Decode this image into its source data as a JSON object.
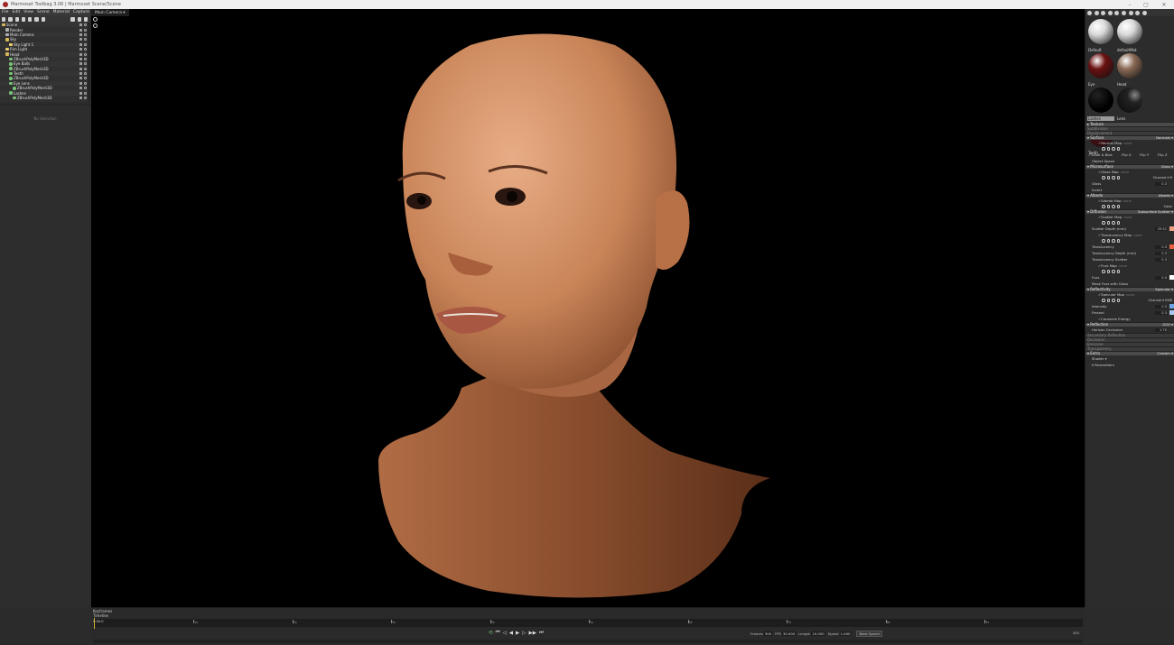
{
  "window": {
    "title": "Marmoset Toolbag 3.06 | Marmoset Scene/Scene",
    "controls": [
      "–",
      "▢",
      "✕"
    ]
  },
  "menu": [
    "File",
    "Edit",
    "View",
    "Scene",
    "Material",
    "Capture",
    "Help"
  ],
  "outliner": {
    "items": [
      {
        "label": "Scene",
        "indent": 0,
        "type": "fold"
      },
      {
        "label": "Render",
        "indent": 1,
        "type": "cam"
      },
      {
        "label": "Main Camera",
        "indent": 1,
        "type": "cam"
      },
      {
        "label": "Sky",
        "indent": 1,
        "type": "fold"
      },
      {
        "label": "Sky Light 1",
        "indent": 2,
        "type": "light"
      },
      {
        "label": "Rim Light",
        "indent": 1,
        "type": "light"
      },
      {
        "label": "Head",
        "indent": 1,
        "type": "fold"
      },
      {
        "label": "ZBrushPolyMesh3D",
        "indent": 2,
        "type": "mesh"
      },
      {
        "label": "Eye Balls",
        "indent": 2,
        "type": "mesh"
      },
      {
        "label": "ZBrushPolyMesh3D",
        "indent": 2,
        "type": "mesh"
      },
      {
        "label": "Teeth",
        "indent": 2,
        "type": "mesh"
      },
      {
        "label": "ZBrushPolyMesh3D",
        "indent": 2,
        "type": "mesh"
      },
      {
        "label": "Eye Lens",
        "indent": 2,
        "type": "mesh"
      },
      {
        "label": "ZBrushPolyMesh3D",
        "indent": 3,
        "type": "mesh"
      },
      {
        "label": "Lashes",
        "indent": 2,
        "type": "mesh"
      },
      {
        "label": "ZBrushPolyMesh3D",
        "indent": 3,
        "type": "mesh"
      }
    ]
  },
  "properties": {
    "empty_label": "No Selection"
  },
  "viewport": {
    "camera_tab": "Main Camera ▾"
  },
  "materials": [
    {
      "label": "Default",
      "color": "#d9d9d9",
      "style": "plain"
    },
    {
      "label": "defaultMat",
      "color": "#d9d9d9",
      "style": "plain"
    },
    {
      "label": "Eye",
      "color": "#6a1010",
      "style": "dark"
    },
    {
      "label": "Head",
      "color": "#8a6a55",
      "style": "skin"
    },
    {
      "label": "Lashes",
      "color": "#050505",
      "style": "black",
      "selected": true
    },
    {
      "label": "Lens",
      "color": "#1a1a1a",
      "style": "glass"
    },
    {
      "label": "Teeth",
      "color": "#4a0e12",
      "style": "teeth"
    }
  ],
  "sections": [
    {
      "kind": "sec",
      "label": "▸ Texture",
      "value": ""
    },
    {
      "kind": "sec",
      "label": "Subdivision",
      "value": "",
      "dim": true
    },
    {
      "kind": "sec",
      "label": "Displacement",
      "value": "",
      "dim": true
    },
    {
      "kind": "sec",
      "label": "▾ Surface",
      "value": "Normals ▾"
    },
    {
      "kind": "row",
      "label": "✓Normal Map",
      "hint": "none"
    },
    {
      "kind": "icons"
    },
    {
      "kind": "flips",
      "label": "✓Scale & Bias",
      "items": [
        "Flip X",
        "Flip Y",
        "Flip Z"
      ]
    },
    {
      "kind": "row",
      "label": "Object Space"
    },
    {
      "kind": "sec",
      "label": "▾ Microsurface",
      "value": "Gloss ▾"
    },
    {
      "kind": "row",
      "label": "✓Gloss Map",
      "hint": "none"
    },
    {
      "kind": "icons",
      "extra": "Channel ▾ R"
    },
    {
      "kind": "row",
      "label": "Gloss",
      "value": "0.3"
    },
    {
      "kind": "row",
      "label": "Invert"
    },
    {
      "kind": "sec",
      "label": "▾ Albedo",
      "value": "Albedo ▾"
    },
    {
      "kind": "row",
      "label": "✓Albedo Map",
      "hint": "none"
    },
    {
      "kind": "icons",
      "extra": "Color"
    },
    {
      "kind": "sec",
      "label": "▾ Diffusion",
      "value": "Subsurface Scatter ▾"
    },
    {
      "kind": "row",
      "label": "✓Scatter Map",
      "hint": "none"
    },
    {
      "kind": "icons"
    },
    {
      "kind": "row",
      "label": "Scatter Depth (mm)",
      "value": "29.51",
      "swatch": "#f0a080"
    },
    {
      "kind": "row",
      "label": "✓Translucency Map",
      "hint": "none"
    },
    {
      "kind": "icons"
    },
    {
      "kind": "row",
      "label": "Translucency",
      "value": "0.3",
      "swatch": "#e86040"
    },
    {
      "kind": "row",
      "label": "Translucency Depth (mm)",
      "value": "0.3"
    },
    {
      "kind": "row",
      "label": "Translucency Scatter",
      "value": "0.3"
    },
    {
      "kind": "row",
      "label": "✓Fuzz Map",
      "hint": "none"
    },
    {
      "kind": "icons"
    },
    {
      "kind": "row",
      "label": "Fuzz",
      "value": "0.0",
      "swatch": "#ffffff"
    },
    {
      "kind": "row",
      "label": "Mask Fuzz with Gloss"
    },
    {
      "kind": "sec",
      "label": "▾ Reflectivity",
      "value": "Specular ▾"
    },
    {
      "kind": "row",
      "label": "✓Specular Map",
      "hint": "none"
    },
    {
      "kind": "icons",
      "extra": "Channel ▾ RGB"
    },
    {
      "kind": "row",
      "label": "Intensity",
      "value": "0.3",
      "swatch": "#6fa0e0"
    },
    {
      "kind": "row",
      "label": "Fresnel",
      "value": "0.3",
      "swatch": "#a8c8f0"
    },
    {
      "kind": "row",
      "label": "✓Conserve Energy"
    },
    {
      "kind": "sec",
      "label": "▾ Reflection",
      "value": "GGX ▾"
    },
    {
      "kind": "row",
      "label": "Horizon Occlusion",
      "value": "1.70"
    },
    {
      "kind": "sec",
      "label": "Secondary Reflection",
      "value": "",
      "dim": true
    },
    {
      "kind": "sec",
      "label": "Occlusion",
      "value": "",
      "dim": true
    },
    {
      "kind": "sec",
      "label": "Emissive",
      "value": "",
      "dim": true
    },
    {
      "kind": "sec",
      "label": "Transparency",
      "value": "",
      "dim": true
    },
    {
      "kind": "sec",
      "label": "▾ Extra",
      "value": "Custom ▾"
    },
    {
      "kind": "row",
      "label": "Shader ▾"
    },
    {
      "kind": "row",
      "label": "▾ Parameters"
    }
  ],
  "timeline": {
    "keyframes_label": "Keyframes",
    "timeline_label": "Timeline",
    "start": "0:00.0",
    "ticks": [
      "1s",
      "2s",
      "3s",
      "4s",
      "5s",
      "6s",
      "7s",
      "8s",
      "9s"
    ],
    "transport": [
      "⟲",
      "⏮",
      "◁",
      "◀",
      "▶",
      "▷",
      "▶▶",
      "⏭"
    ],
    "frames_label": "Frames",
    "frames": "300",
    "fps_label": "FPS",
    "fps": "30.000",
    "length_label": "Length",
    "length": "10.000",
    "speed_label": "Speed",
    "speed": "1.000",
    "bake_label": "Bake Speed",
    "end_value": "300"
  }
}
